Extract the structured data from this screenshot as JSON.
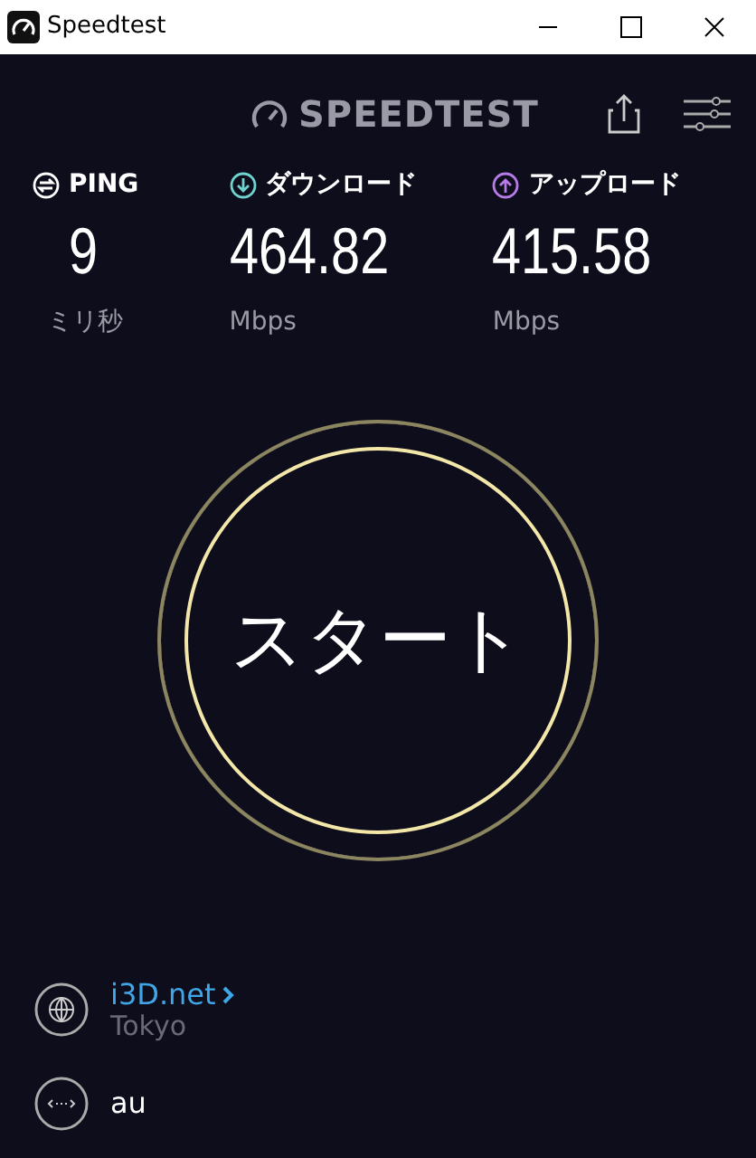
{
  "window": {
    "title": "Speedtest"
  },
  "header": {
    "logo": "SPEEDTEST"
  },
  "metrics": [
    {
      "kind": "ping",
      "label": "PING",
      "value": "9",
      "unit": "ミリ秒",
      "color": "#ffffff"
    },
    {
      "kind": "download",
      "label": "ダウンロード",
      "value": "464.82",
      "unit": "Mbps",
      "color": "#6fd3d0"
    },
    {
      "kind": "upload",
      "label": "アップロード",
      "value": "415.58",
      "unit": "Mbps",
      "color": "#b77be8"
    }
  ],
  "start_button": {
    "label": "スタート"
  },
  "server": {
    "name": "i3D.net",
    "location": "Tokyo"
  },
  "provider": {
    "name": "au"
  }
}
